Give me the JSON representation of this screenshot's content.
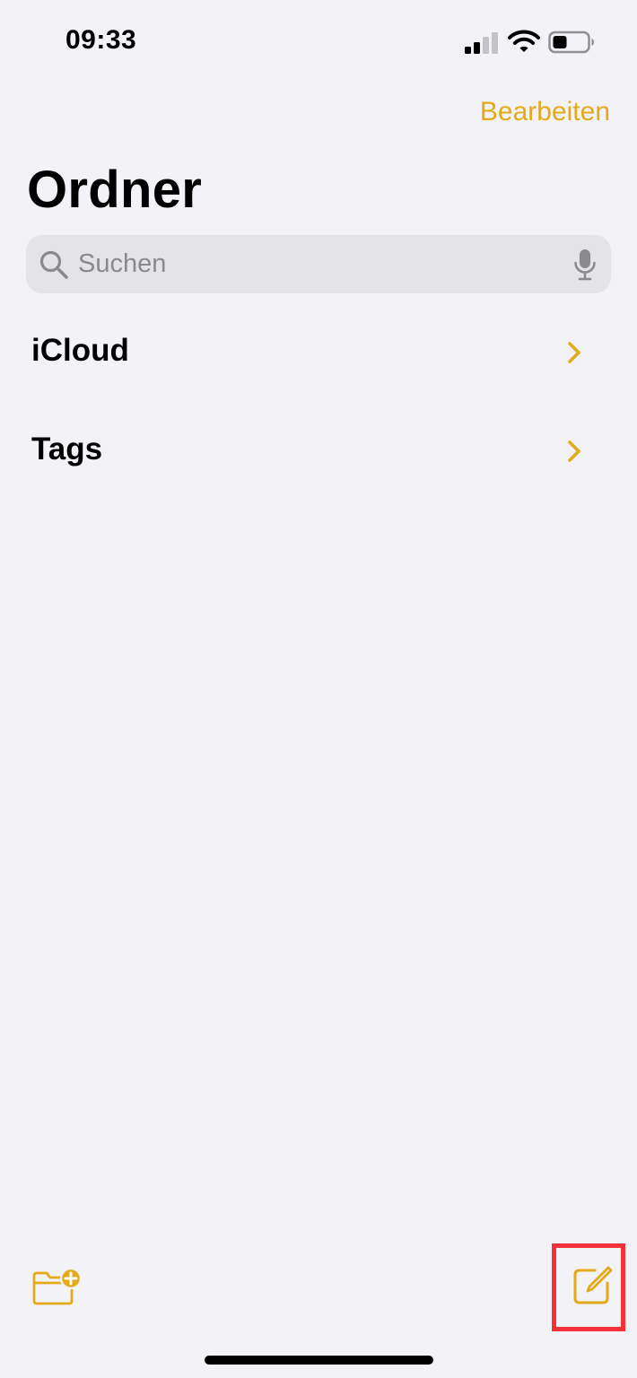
{
  "status_bar": {
    "time": "09:33"
  },
  "nav": {
    "edit_label": "Bearbeiten",
    "title": "Ordner"
  },
  "search": {
    "placeholder": "Suchen"
  },
  "folders": [
    {
      "label": "iCloud"
    },
    {
      "label": "Tags"
    }
  ],
  "toolbar": {
    "new_folder_icon": "folder-badge-plus-icon",
    "compose_icon": "square-and-pencil-icon"
  },
  "colors": {
    "accent": "#e3aa1a",
    "background": "#f2f2f7",
    "search_field": "#e3e3e8",
    "highlight": "#f5323a"
  }
}
